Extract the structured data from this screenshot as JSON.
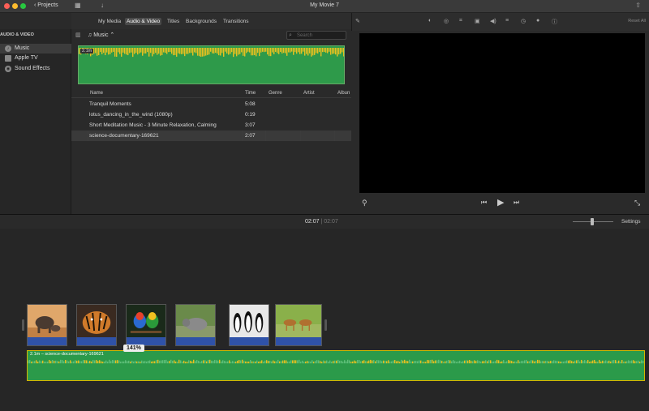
{
  "titlebar": {
    "projects_label": "Projects",
    "window_title": "My Movie 7"
  },
  "browser_tabs": [
    "My Media",
    "Audio & Video",
    "Titles",
    "Backgrounds",
    "Transitions"
  ],
  "sidebar": {
    "header": "AUDIO & VIDEO",
    "items": [
      {
        "label": "Music",
        "icon": "music-icon"
      },
      {
        "label": "Apple TV",
        "icon": "tv-icon"
      },
      {
        "label": "Sound Effects",
        "icon": "sound-icon"
      }
    ]
  },
  "browser": {
    "source_select": "Music",
    "search_placeholder": "Search",
    "preview_length": "2.1m",
    "columns": [
      "Name",
      "Time",
      "Genre",
      "Artist",
      "Albun"
    ],
    "rows": [
      {
        "name": "Tranquil Moments",
        "time": "5:08"
      },
      {
        "name": "lotus_dancing_in_the_wind (1080p)",
        "time": "0:19"
      },
      {
        "name": "Short Meditation Music - 3 Minute Relaxation, Calming",
        "time": "3:07"
      },
      {
        "name": "science-documentary-169621",
        "time": "2:07"
      }
    ]
  },
  "viewer": {
    "reset_all": "Reset All"
  },
  "timeline": {
    "timecode_current": "02:07",
    "timecode_separator": "|",
    "timecode_total": "02:07",
    "settings_label": "Settings",
    "music_track_label": "2.1m – science-documentary-169621",
    "volume_tag": "141%",
    "clips": [
      "elephants",
      "tiger",
      "parrots",
      "rhino",
      "penguins",
      "antelopes"
    ]
  },
  "colors": {
    "music_green": "#2b9a4a",
    "wave_yellow": "#e8c020",
    "audio_blue": "#2f52a8",
    "selection": "#d4b600"
  }
}
